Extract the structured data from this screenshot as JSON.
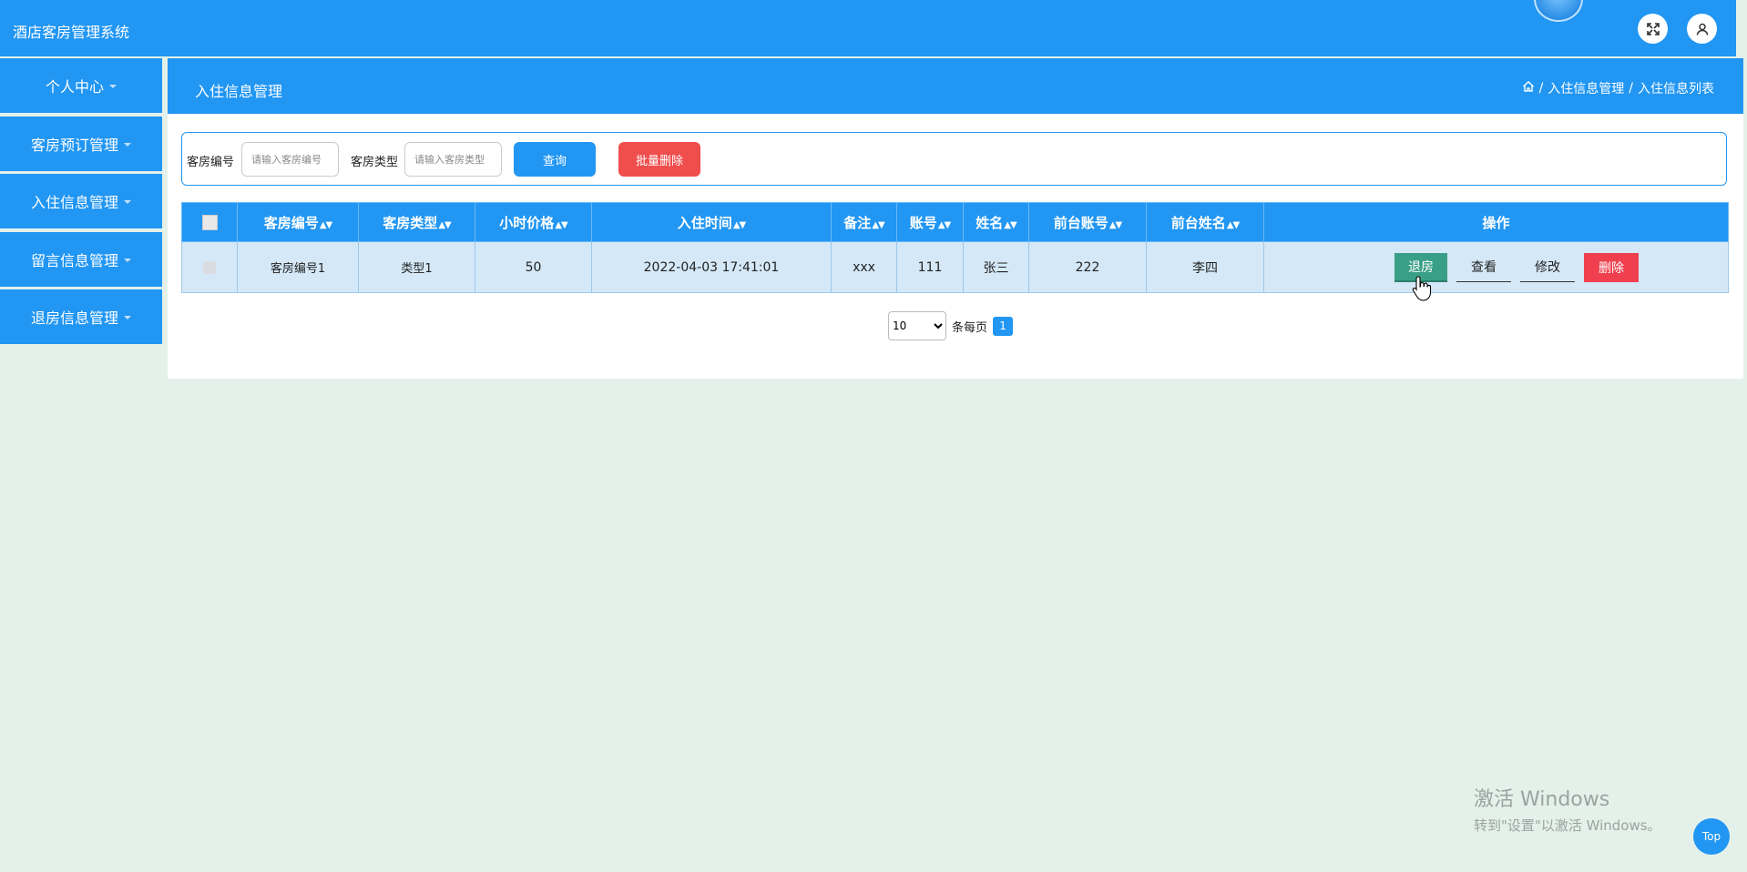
{
  "app": {
    "title": "酒店客房管理系统"
  },
  "sidebar": {
    "items": [
      {
        "label": "个人中心"
      },
      {
        "label": "客房预订管理"
      },
      {
        "label": "入住信息管理"
      },
      {
        "label": "留言信息管理"
      },
      {
        "label": "退房信息管理"
      }
    ]
  },
  "header": {
    "title": "入住信息管理",
    "breadcrumb": [
      "入住信息管理",
      "入住信息列表"
    ],
    "separator": "/"
  },
  "search": {
    "room_no_label": "客房编号",
    "room_no_placeholder": "请输入客房编号",
    "room_type_label": "客房类型",
    "room_type_placeholder": "请输入客房类型",
    "query_label": "查询",
    "batch_delete_label": "批量删除"
  },
  "table": {
    "columns": [
      "客房编号",
      "客房类型",
      "小时价格",
      "入住时间",
      "备注",
      "账号",
      "姓名",
      "前台账号",
      "前台姓名",
      "操作"
    ],
    "rows": [
      {
        "room_no": "客房编号1",
        "room_type": "类型1",
        "hourly_price": "50",
        "checkin_time": "2022-04-03 17:41:01",
        "remark": "xxx",
        "account": "111",
        "name": "张三",
        "desk_account": "222",
        "desk_name": "李四"
      }
    ],
    "actions": {
      "checkout": "退房",
      "view": "查看",
      "edit": "修改",
      "delete": "删除"
    }
  },
  "pagination": {
    "page_size": "10",
    "per_page_label": "条每页",
    "current_page": "1"
  },
  "watermark": {
    "title": "激活 Windows",
    "subtitle": "转到\"设置\"以激活 Windows。"
  },
  "top_button": {
    "label": "Top"
  },
  "colors": {
    "primary": "#2196f3",
    "danger": "#f04d4d",
    "checkout": "#3a9f87",
    "background": "#e4f1ea"
  }
}
